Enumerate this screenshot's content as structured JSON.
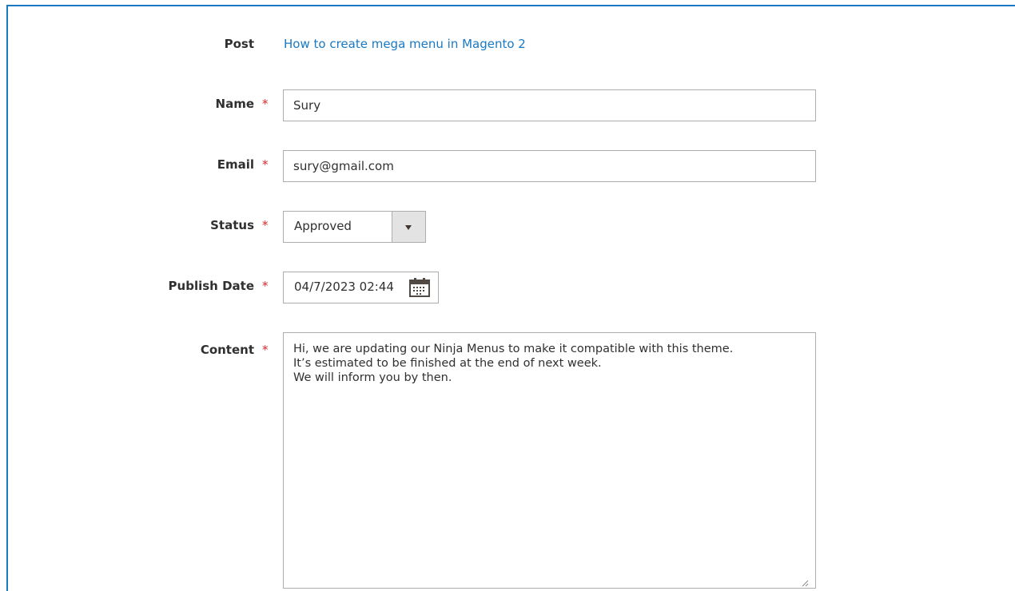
{
  "form": {
    "post": {
      "label": "Post",
      "link_text": "How to create mega menu in Magento 2"
    },
    "name": {
      "label": "Name",
      "required_mark": "*",
      "value": "Sury"
    },
    "email": {
      "label": "Email",
      "required_mark": "*",
      "value": "sury@gmail.com"
    },
    "status": {
      "label": "Status",
      "required_mark": "*",
      "selected": "Approved"
    },
    "publish_date": {
      "label": "Publish Date",
      "required_mark": "*",
      "value": "04/7/2023 02:44"
    },
    "content": {
      "label": "Content",
      "required_mark": "*",
      "value": "Hi, we are updating our Ninja Menus to make it compatible with this theme.\nIt’s estimated to be finished at the end of next week.\nWe will inform you by then."
    }
  },
  "colors": {
    "accent": "#1979c3",
    "required": "#e22626",
    "border": "#adadad"
  },
  "icons": {
    "calendar": "calendar-icon",
    "dropdown": "chevron-down-icon",
    "resize": "resize-handle-icon"
  }
}
